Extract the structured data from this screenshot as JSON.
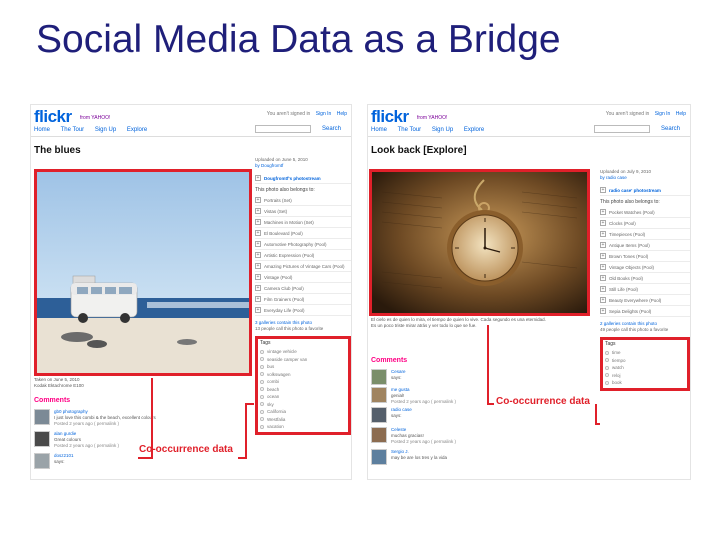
{
  "slide": {
    "title": "Social Media Data as a Bridge"
  },
  "left": {
    "logo": "flickr",
    "from": "from YAHOO!",
    "topright": {
      "status": "You aren't signed in",
      "signin": "Sign In",
      "help": "Help"
    },
    "nav": [
      "Home",
      "The Tour",
      "Sign Up",
      "Explore"
    ],
    "search": "Search",
    "page_title": "The blues",
    "uploaded": "Uploaded on June 5, 2010",
    "by": "by Dougfromtf",
    "stream": "Dougfromtf's photostream",
    "belongs": "This photo also belongs to:",
    "sets": [
      "Portraits (Set)",
      "Vistas (Set)",
      "Machines in Motion (Set)",
      "El Boulevard (Pool)",
      "Automotive Photography (Pool)",
      "Artistic Expression (Pool)",
      "Amazing Pictures of Vintage Cars (Pool)",
      "Vintage (Pool)",
      "Camera Club (Pool)",
      "Film Grainers (Pool)",
      "Everyday Life (Pool)"
    ],
    "fav_line1": "3 galleries contain this photo",
    "fav_line2": "13 people call this photo a favorite",
    "tags_title": "Tags",
    "tags": [
      "vintage vehicle",
      "seaside camper van",
      "bus",
      "volkswagen",
      "combi",
      "beach",
      "ocean",
      "sky",
      "California",
      "Westfalia",
      "vacation"
    ],
    "caption1": "Taken on June 5, 2010",
    "caption2": "Kodak Ektachrome E100",
    "comments_head": "Comments",
    "comments": [
      {
        "name": "gb0 photography",
        "text": "I just love this combi & the beach, excellent colours",
        "meta": "Posted 2 years ago ( permalink )"
      },
      {
        "name": "alan gurdie",
        "text": "Great colours",
        "meta": "Posted 2 years ago ( permalink )"
      },
      {
        "name": "dosz2101",
        "text": "says:",
        "meta": ""
      }
    ],
    "cooc": "Co-occurrence data"
  },
  "right": {
    "logo": "flickr",
    "from": "from YAHOO!",
    "topright": {
      "status": "You aren't signed in",
      "signin": "Sign In",
      "help": "Help"
    },
    "nav": [
      "Home",
      "The Tour",
      "Sign Up",
      "Explore"
    ],
    "search": "Search",
    "page_title": "Look back [Explore]",
    "uploaded": "Uploaded on July 9, 2010",
    "by": "by radio case",
    "stream": "radio case' photostream",
    "belongs": "This photo also belongs to:",
    "sets": [
      "Pocket Watches (Pool)",
      "Clocks (Pool)",
      "Timepieces (Pool)",
      "Antique Items (Pool)",
      "Brown Tones (Pool)",
      "Vintage Objects (Pool)",
      "Old Books (Pool)",
      "Still Life (Pool)",
      "Beauty Everywhere (Pool)",
      "Sepia Delights (Pool)"
    ],
    "fav_line1": "2 galleries contain this photo",
    "fav_line2": "49 people call this photo a favorite",
    "tags_title": "Tags",
    "tags": [
      "time",
      "tiempo",
      "watch",
      "reloj",
      "book"
    ],
    "caption1": "El cielo es de quien lo mira, el tiempo de quien lo vive. Cada segundo es una eternidad.",
    "caption2": "Es un poco triste mirar atrás y ver todo lo que se fue.",
    "comments_head": "Comments",
    "comments": [
      {
        "name": "Cesare",
        "text": "says:",
        "meta": ""
      },
      {
        "name": "me gusta",
        "text": "genial!",
        "meta": "Posted 2 years ago ( permalink )"
      },
      {
        "name": "radio case",
        "text": "says:",
        "meta": ""
      },
      {
        "name": "Celeste",
        "text": "muchas gracias!",
        "meta": "Posted 2 years ago ( permalink )"
      },
      {
        "name": "Sergio J.",
        "text": "may be are los tres y la vida",
        "meta": ""
      }
    ],
    "cooc": "Co-occurrence data"
  },
  "colors": {
    "title": "#1f1f7a",
    "highlight": "#e0202a",
    "flickr_blue": "#0063dc",
    "flickr_pink": "#ff0084"
  }
}
